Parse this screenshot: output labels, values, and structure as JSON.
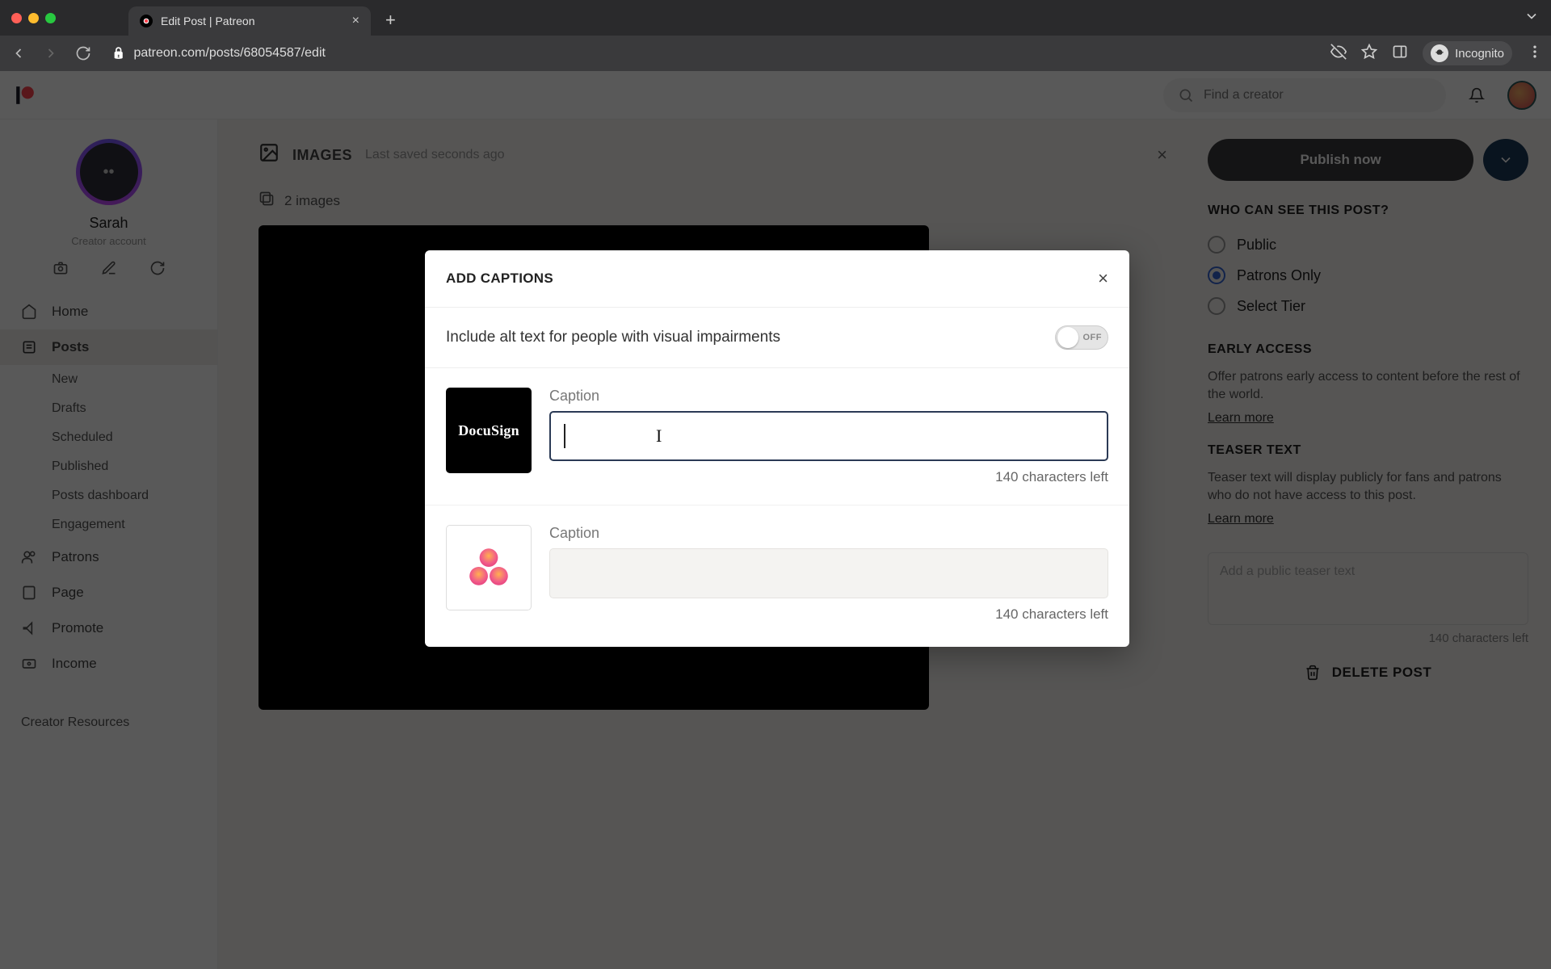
{
  "browser": {
    "tab_title": "Edit Post | Patreon",
    "url": "patreon.com/posts/68054587/edit",
    "incognito_label": "Incognito"
  },
  "topnav": {
    "search_placeholder": "Find a creator"
  },
  "sidebar": {
    "creator_name": "Sarah",
    "creator_sub": "Creator account",
    "items": {
      "home": "Home",
      "posts": "Posts",
      "patrons": "Patrons",
      "page": "Page",
      "promote": "Promote",
      "income": "Income"
    },
    "post_sub": {
      "new": "New",
      "drafts": "Drafts",
      "scheduled": "Scheduled",
      "published": "Published",
      "dashboard": "Posts dashboard",
      "engagement": "Engagement"
    },
    "bottom_link": "Creator Resources"
  },
  "post": {
    "header_label": "IMAGES",
    "saved_text": "Last saved seconds ago",
    "images_count": "2 images"
  },
  "publish": {
    "button": "Publish now"
  },
  "visibility": {
    "section": "WHO CAN SEE THIS POST?",
    "public": "Public",
    "patrons": "Patrons Only",
    "tier": "Select Tier"
  },
  "early_access": {
    "section": "EARLY ACCESS",
    "desc": "Offer patrons early access to content before the rest of the world.",
    "learn": "Learn more"
  },
  "teaser": {
    "section": "TEASER TEXT",
    "desc": "Teaser text will display publicly for fans and patrons who do not have access to this post.",
    "learn": "Learn more",
    "placeholder": "Add a public teaser text",
    "chars": "140 characters left"
  },
  "delete_post": "DELETE POST",
  "modal": {
    "title": "ADD CAPTIONS",
    "alt_text_label": "Include alt text for people with visual impairments",
    "toggle_state": "OFF",
    "captions": [
      {
        "label": "Caption",
        "value": "",
        "chars_left": "140 characters left",
        "thumb": "docusign",
        "thumb_text": "DocuSign",
        "focused": true
      },
      {
        "label": "Caption",
        "value": "",
        "chars_left": "140 characters left",
        "thumb": "asana",
        "focused": false
      }
    ]
  }
}
